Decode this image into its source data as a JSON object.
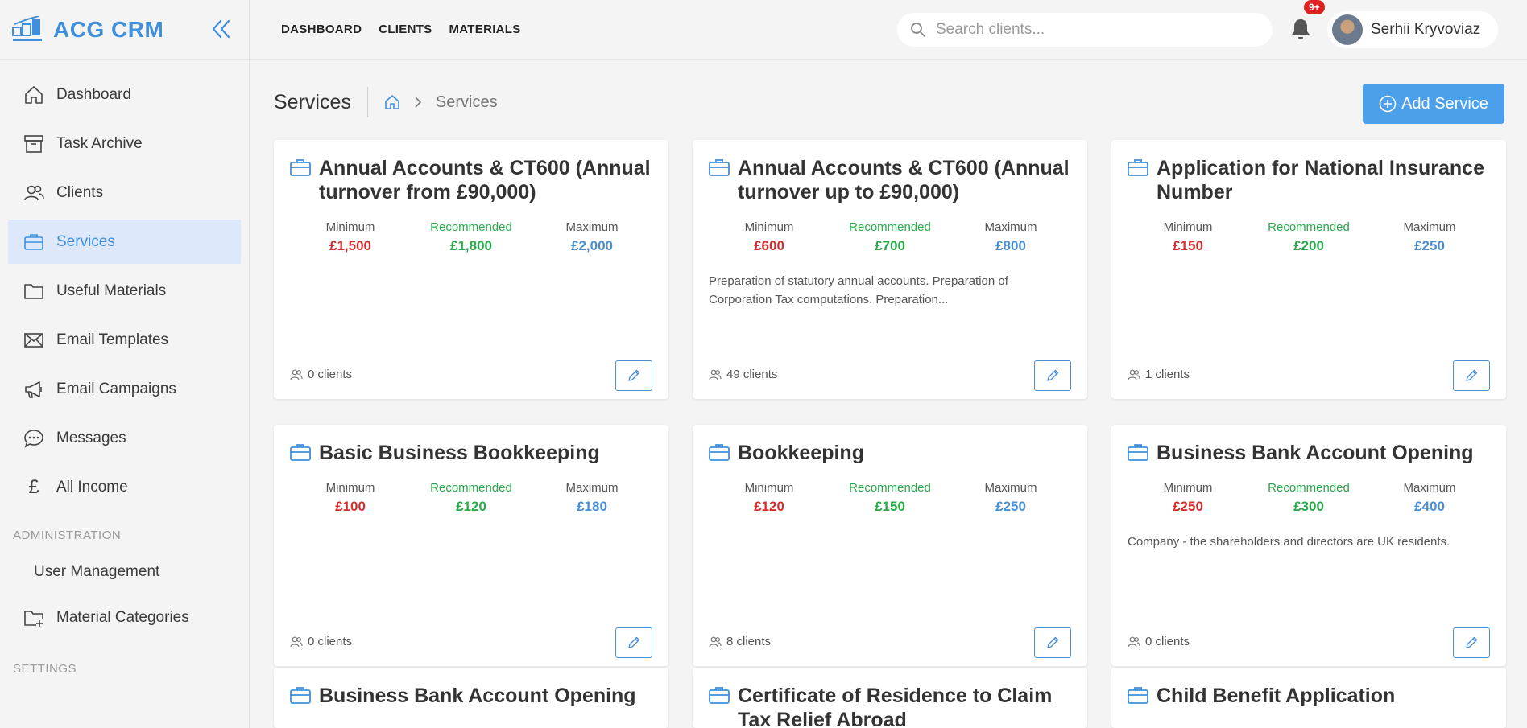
{
  "app": {
    "name": "ACG CRM"
  },
  "sidebar": {
    "items": [
      {
        "label": "Dashboard",
        "icon": "home-icon"
      },
      {
        "label": "Task Archive",
        "icon": "archive-icon"
      },
      {
        "label": "Clients",
        "icon": "users-icon"
      },
      {
        "label": "Services",
        "icon": "briefcase-icon",
        "active": true
      },
      {
        "label": "Useful Materials",
        "icon": "folder-icon"
      },
      {
        "label": "Email Templates",
        "icon": "envelope-icon"
      },
      {
        "label": "Email Campaigns",
        "icon": "megaphone-icon"
      },
      {
        "label": "Messages",
        "icon": "chat-icon"
      },
      {
        "label": "All Income",
        "icon": "pound-icon"
      }
    ],
    "admin_label": "ADMINISTRATION",
    "admin_items": [
      {
        "label": "User Management"
      },
      {
        "label": "Material Categories",
        "icon": "folder-plus-icon"
      }
    ],
    "settings_label": "SETTINGS"
  },
  "topbar": {
    "nav": [
      "DASHBOARD",
      "CLIENTS",
      "MATERIALS"
    ],
    "search_placeholder": "Search clients...",
    "notification_badge": "9+",
    "user_name": "Serhii Kryvoviaz"
  },
  "page": {
    "title": "Services",
    "breadcrumb": "Services",
    "add_button": "Add Service"
  },
  "labels": {
    "min": "Minimum",
    "rec": "Recommended",
    "max": "Maximum"
  },
  "colors": {
    "accent": "#3f8fdb",
    "min": "#d32f2f",
    "rec": "#2aa84a",
    "max": "#4b8fd3",
    "badge": "#e02020"
  },
  "cards": [
    {
      "title": "Annual Accounts & CT600 (Annual turnover from £90,000)",
      "min": "£1,500",
      "rec": "£1,800",
      "max": "£2,000",
      "desc": "",
      "clients": "0 clients"
    },
    {
      "title": "Annual Accounts & CT600 (Annual turnover up to £90,000)",
      "min": "£600",
      "rec": "£700",
      "max": "£800",
      "desc": "Preparation of statutory annual accounts. Preparation of Corporation Tax computations. Preparation...",
      "clients": "49 clients"
    },
    {
      "title": "Application for National Insurance Number",
      "min": "£150",
      "rec": "£200",
      "max": "£250",
      "desc": "",
      "clients": "1 clients"
    },
    {
      "title": "Basic Business Bookkeeping",
      "min": "£100",
      "rec": "£120",
      "max": "£180",
      "desc": "",
      "clients": "0 clients"
    },
    {
      "title": "Bookkeeping",
      "min": "£120",
      "rec": "£150",
      "max": "£250",
      "desc": "",
      "clients": "8 clients"
    },
    {
      "title": "Business Bank Account Opening",
      "min": "£250",
      "rec": "£300",
      "max": "£400",
      "desc": "Company - the shareholders and directors are UK residents.",
      "clients": "0 clients"
    },
    {
      "title": "Business Bank Account Opening",
      "min": "",
      "rec": "",
      "max": "",
      "desc": "",
      "clients": ""
    },
    {
      "title": "Certificate of Residence to Claim Tax Relief Abroad",
      "min": "",
      "rec": "",
      "max": "",
      "desc": "",
      "clients": ""
    },
    {
      "title": "Child Benefit Application",
      "min": "",
      "rec": "",
      "max": "",
      "desc": "",
      "clients": ""
    }
  ]
}
